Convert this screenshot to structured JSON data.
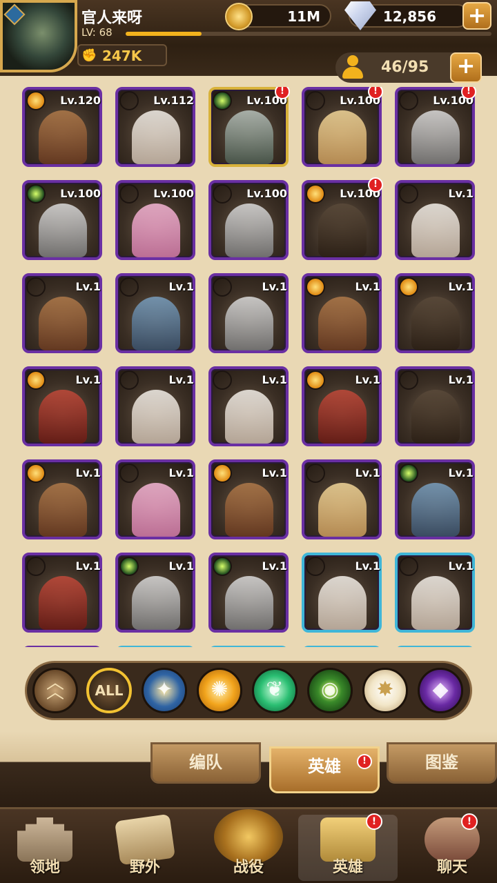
{
  "player": {
    "name": "官人来呀",
    "level_label": "LV: 68",
    "power": "247K"
  },
  "currencies": {
    "gold": "11M",
    "gems": "12,856"
  },
  "hero_count": "46/95",
  "plus_symbol": "+",
  "alert_symbol": "!",
  "heroes": [
    {
      "level": "Lv.120",
      "faction": "fire",
      "alert": false,
      "frame": "purple",
      "portrait": "a"
    },
    {
      "level": "Lv.112",
      "faction": "nature",
      "alert": false,
      "frame": "purple",
      "portrait": "b"
    },
    {
      "level": "Lv.100",
      "faction": "eye",
      "alert": true,
      "frame": "gold",
      "portrait": "c"
    },
    {
      "level": "Lv.100",
      "faction": "light",
      "alert": true,
      "frame": "purple",
      "portrait": "d"
    },
    {
      "level": "Lv.100",
      "faction": "light",
      "alert": true,
      "frame": "purple",
      "portrait": "e"
    },
    {
      "level": "Lv.100",
      "faction": "eye",
      "alert": false,
      "frame": "purple",
      "portrait": "e"
    },
    {
      "level": "Lv.100",
      "faction": "nature",
      "alert": false,
      "frame": "purple",
      "portrait": "f"
    },
    {
      "level": "Lv.100",
      "faction": "nature",
      "alert": false,
      "frame": "purple",
      "portrait": "e"
    },
    {
      "level": "Lv.100",
      "faction": "fire",
      "alert": true,
      "frame": "purple",
      "portrait": "g"
    },
    {
      "level": "Lv.1",
      "faction": "nature",
      "alert": false,
      "frame": "purple",
      "portrait": "b"
    },
    {
      "level": "Lv.1",
      "faction": "nature",
      "alert": false,
      "frame": "purple",
      "portrait": "a"
    },
    {
      "level": "Lv.1",
      "faction": "light",
      "alert": false,
      "frame": "purple",
      "portrait": "i"
    },
    {
      "level": "Lv.1",
      "faction": "light",
      "alert": false,
      "frame": "purple",
      "portrait": "e"
    },
    {
      "level": "Lv.1",
      "faction": "fire",
      "alert": false,
      "frame": "purple",
      "portrait": "a"
    },
    {
      "level": "Lv.1",
      "faction": "fire",
      "alert": false,
      "frame": "purple",
      "portrait": "g"
    },
    {
      "level": "Lv.1",
      "faction": "fire",
      "alert": false,
      "frame": "purple",
      "portrait": "h"
    },
    {
      "level": "Lv.1",
      "faction": "nature",
      "alert": false,
      "frame": "purple",
      "portrait": "b"
    },
    {
      "level": "Lv.1",
      "faction": "nature",
      "alert": false,
      "frame": "purple",
      "portrait": "b"
    },
    {
      "level": "Lv.1",
      "faction": "fire",
      "alert": false,
      "frame": "purple",
      "portrait": "h"
    },
    {
      "level": "Lv.1",
      "faction": "light",
      "alert": false,
      "frame": "purple",
      "portrait": "g"
    },
    {
      "level": "Lv.1",
      "faction": "fire",
      "alert": false,
      "frame": "purple",
      "portrait": "a"
    },
    {
      "level": "Lv.1",
      "faction": "light",
      "alert": false,
      "frame": "purple",
      "portrait": "f"
    },
    {
      "level": "Lv.1",
      "faction": "fire",
      "alert": false,
      "frame": "purple",
      "portrait": "a"
    },
    {
      "level": "Lv.1",
      "faction": "light",
      "alert": false,
      "frame": "purple",
      "portrait": "d"
    },
    {
      "level": "Lv.1",
      "faction": "eye",
      "alert": false,
      "frame": "purple",
      "portrait": "i"
    },
    {
      "level": "Lv.1",
      "faction": "light",
      "alert": false,
      "frame": "purple",
      "portrait": "h"
    },
    {
      "level": "Lv.1",
      "faction": "eye",
      "alert": false,
      "frame": "purple",
      "portrait": "e"
    },
    {
      "level": "Lv.1",
      "faction": "eye",
      "alert": false,
      "frame": "purple",
      "portrait": "e"
    },
    {
      "level": "Lv.1",
      "faction": "nature",
      "alert": false,
      "frame": "blue",
      "portrait": "b"
    },
    {
      "level": "Lv.1",
      "faction": "nature",
      "alert": false,
      "frame": "blue",
      "portrait": "b"
    }
  ],
  "filters": [
    {
      "id": "collapse",
      "label": ""
    },
    {
      "id": "all",
      "label": "ALL"
    },
    {
      "id": "light",
      "label": ""
    },
    {
      "id": "fire",
      "label": ""
    },
    {
      "id": "nature",
      "label": ""
    },
    {
      "id": "eye",
      "label": ""
    },
    {
      "id": "holy",
      "label": ""
    },
    {
      "id": "dark",
      "label": ""
    }
  ],
  "subtabs": {
    "formation": "编队",
    "heroes": "英雄",
    "codex": "图鉴"
  },
  "nav": {
    "territory": "领地",
    "outdoor": "野外",
    "battle": "战役",
    "heroes": "英雄",
    "chat": "聊天"
  },
  "colors": {
    "frame_purple": "#6a2fa3",
    "frame_gold": "#d8b23a",
    "frame_blue": "#3fb6d8",
    "accent_gold": "#f2b21d",
    "alert_red": "#e02121"
  }
}
